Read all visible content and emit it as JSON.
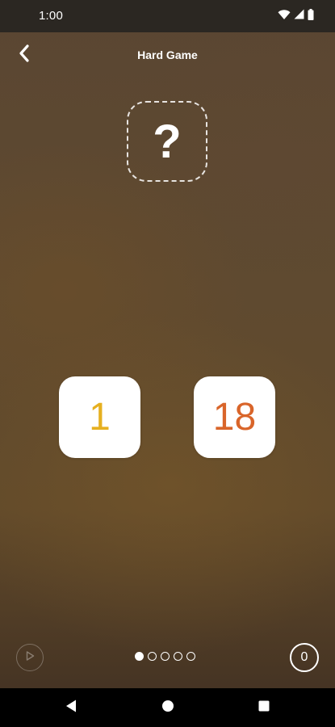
{
  "status_bar": {
    "time": "1:00",
    "icons": [
      "wifi-icon",
      "cellular-signal-icon",
      "battery-icon"
    ]
  },
  "header": {
    "title": "Hard Game",
    "back_icon": "chevron-left-icon"
  },
  "answer_slot": {
    "symbol": "?"
  },
  "tiles": [
    {
      "value": "1",
      "color": "#e6b020"
    },
    {
      "value": "18",
      "color": "#d9652a"
    }
  ],
  "bottom_bar": {
    "play_icon": "play-circle-icon",
    "pager": {
      "total": 5,
      "active_index": 0
    },
    "score": "0"
  },
  "nav_bar": {
    "icons": [
      "back-triangle-icon",
      "home-circle-icon",
      "recents-square-icon"
    ]
  },
  "colors": {
    "background_brown": "#5f4a30",
    "status_bar": "#2b2722",
    "tile": "#ffffff"
  }
}
